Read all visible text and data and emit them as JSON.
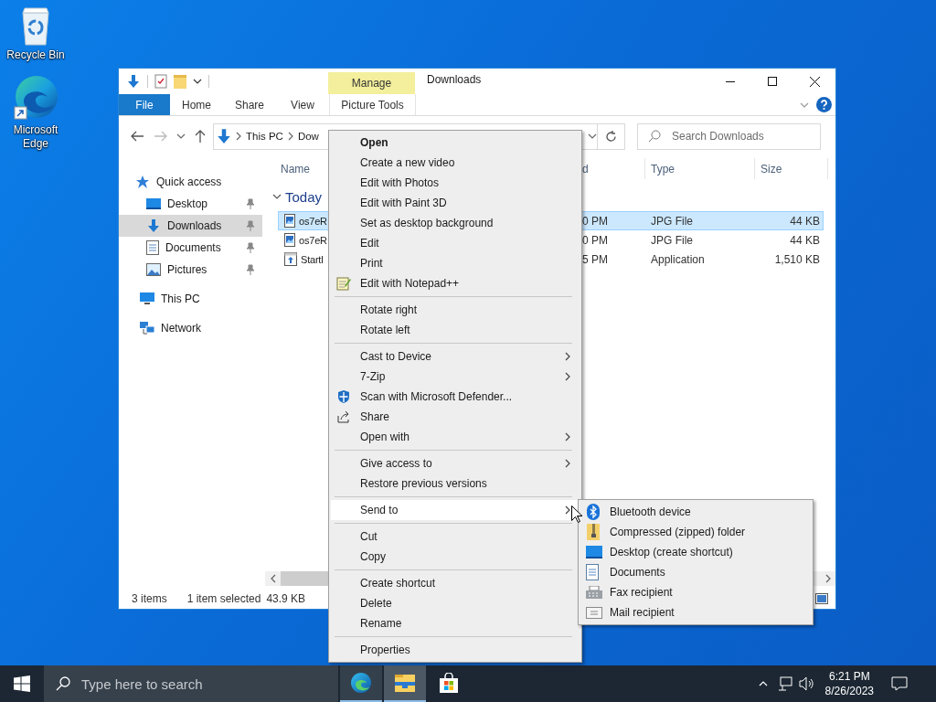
{
  "desktop_icons": [
    {
      "label": "Recycle Bin"
    },
    {
      "label": "Microsoft Edge"
    }
  ],
  "explorer": {
    "title": "Downloads",
    "contextual_group": "Manage",
    "ribbon_tabs": [
      {
        "label": "File",
        "kind": "file"
      },
      {
        "label": "Home",
        "kind": "tab"
      },
      {
        "label": "Share",
        "kind": "tab"
      },
      {
        "label": "View",
        "kind": "tab"
      },
      {
        "label": "Picture Tools",
        "kind": "contextual"
      }
    ],
    "breadcrumb": [
      "This PC",
      "Dow"
    ],
    "search": {
      "placeholder": "Search Downloads"
    },
    "nav": [
      {
        "label": "Quick access",
        "selected": false,
        "pinned": false,
        "children": [
          {
            "label": "Desktop",
            "selected": false,
            "pinned": true
          },
          {
            "label": "Downloads",
            "selected": true,
            "pinned": true
          },
          {
            "label": "Documents",
            "selected": false,
            "pinned": true
          },
          {
            "label": "Pictures",
            "selected": false,
            "pinned": true
          }
        ]
      },
      {
        "label": "This PC",
        "selected": false,
        "pinned": false
      },
      {
        "label": "Network",
        "selected": false,
        "pinned": false
      }
    ],
    "columns": [
      "Name",
      "d",
      "Type",
      "Size"
    ],
    "group": {
      "label": "Today",
      "expanded": true
    },
    "rows": [
      {
        "kind": "image",
        "name": "os7eR",
        "date": "0 PM",
        "type": "JPG File",
        "size": "44 KB",
        "selected": true
      },
      {
        "kind": "image",
        "name": "os7eR",
        "date": "0 PM",
        "type": "JPG File",
        "size": "44 KB",
        "selected": false
      },
      {
        "kind": "app",
        "name": "Startl",
        "date": "5 PM",
        "type": "Application",
        "size": "1,510 KB",
        "selected": false
      }
    ],
    "status": {
      "count": "3 items",
      "selection": "1 item selected",
      "size": "43.9 KB"
    }
  },
  "context_menu": {
    "items": [
      {
        "kind": "item",
        "label": "Open",
        "bold": true,
        "highlighted": false,
        "submenu": false
      },
      {
        "kind": "item",
        "label": "Create a new video",
        "bold": false,
        "highlighted": false,
        "submenu": false
      },
      {
        "kind": "item",
        "label": "Edit with Photos",
        "bold": false,
        "highlighted": false,
        "submenu": false
      },
      {
        "kind": "item",
        "label": "Edit with Paint 3D",
        "bold": false,
        "highlighted": false,
        "submenu": false
      },
      {
        "kind": "item",
        "label": "Set as desktop background",
        "bold": false,
        "highlighted": false,
        "submenu": false
      },
      {
        "kind": "item",
        "label": "Edit",
        "bold": false,
        "highlighted": false,
        "submenu": false
      },
      {
        "kind": "item",
        "label": "Print",
        "bold": false,
        "highlighted": false,
        "submenu": false
      },
      {
        "kind": "item",
        "label": "Edit with Notepad++",
        "bold": false,
        "highlighted": false,
        "submenu": false
      },
      {
        "kind": "separator"
      },
      {
        "kind": "item",
        "label": "Rotate right",
        "bold": false,
        "highlighted": false,
        "submenu": false
      },
      {
        "kind": "item",
        "label": "Rotate left",
        "bold": false,
        "highlighted": false,
        "submenu": false
      },
      {
        "kind": "separator"
      },
      {
        "kind": "item",
        "label": "Cast to Device",
        "bold": false,
        "highlighted": false,
        "submenu": true
      },
      {
        "kind": "item",
        "label": "7-Zip",
        "bold": false,
        "highlighted": false,
        "submenu": true
      },
      {
        "kind": "item",
        "label": "Scan with Microsoft Defender...",
        "bold": false,
        "highlighted": false,
        "submenu": false
      },
      {
        "kind": "item",
        "label": "Share",
        "bold": false,
        "highlighted": false,
        "submenu": false
      },
      {
        "kind": "item",
        "label": "Open with",
        "bold": false,
        "highlighted": false,
        "submenu": true
      },
      {
        "kind": "separator"
      },
      {
        "kind": "item",
        "label": "Give access to",
        "bold": false,
        "highlighted": false,
        "submenu": true
      },
      {
        "kind": "item",
        "label": "Restore previous versions",
        "bold": false,
        "highlighted": false,
        "submenu": false
      },
      {
        "kind": "separator"
      },
      {
        "kind": "item",
        "label": "Send to",
        "bold": false,
        "highlighted": true,
        "submenu": true
      },
      {
        "kind": "separator"
      },
      {
        "kind": "item",
        "label": "Cut",
        "bold": false,
        "highlighted": false,
        "submenu": false
      },
      {
        "kind": "item",
        "label": "Copy",
        "bold": false,
        "highlighted": false,
        "submenu": false
      },
      {
        "kind": "separator"
      },
      {
        "kind": "item",
        "label": "Create shortcut",
        "bold": false,
        "highlighted": false,
        "submenu": false
      },
      {
        "kind": "item",
        "label": "Delete",
        "bold": false,
        "highlighted": false,
        "submenu": false
      },
      {
        "kind": "item",
        "label": "Rename",
        "bold": false,
        "highlighted": false,
        "submenu": false
      },
      {
        "kind": "separator"
      },
      {
        "kind": "item",
        "label": "Properties",
        "bold": false,
        "highlighted": false,
        "submenu": false
      }
    ]
  },
  "send_to_menu": {
    "items": [
      {
        "label": "Bluetooth device"
      },
      {
        "label": "Compressed (zipped) folder"
      },
      {
        "label": "Desktop (create shortcut)"
      },
      {
        "label": "Documents"
      },
      {
        "label": "Fax recipient"
      },
      {
        "label": "Mail recipient"
      }
    ]
  },
  "taskbar": {
    "search": {
      "placeholder": "Type here to search"
    },
    "apps": [
      {
        "running": true,
        "selected": false
      },
      {
        "running": true,
        "selected": true
      },
      {
        "running": false,
        "selected": false
      }
    ],
    "time": "6:21 PM",
    "date": "8/26/2023"
  }
}
